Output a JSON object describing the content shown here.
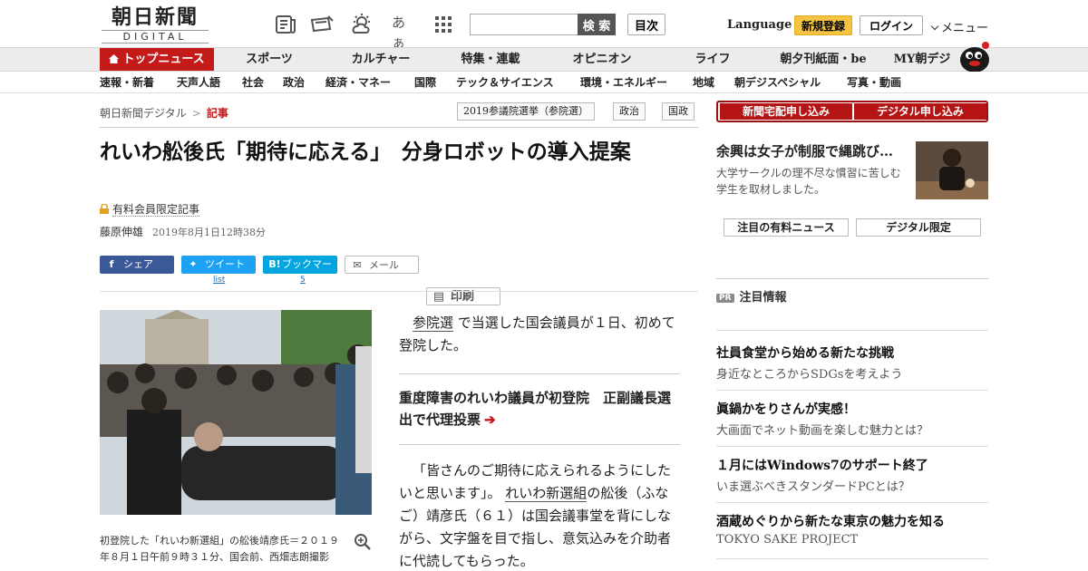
{
  "header": {
    "logo_main": "朝日新聞",
    "logo_sub": "DIGITAL",
    "search_button": "検 索",
    "toc_button": "目次",
    "language": "Language",
    "signup": "新規登録",
    "login": "ログイン",
    "menu": "メニュー",
    "font_icon_label": "あぁ"
  },
  "nav": {
    "items": [
      "トップニュース",
      "スポーツ",
      "カルチャー",
      "特集・連載",
      "オピニオン",
      "ライフ",
      "朝夕刊紙面・be",
      "MY朝デジ"
    ]
  },
  "subnav": {
    "items": [
      "速報・新着",
      "天声人語",
      "社会",
      "政治",
      "経済・マネー",
      "国際",
      "テック＆サイエンス",
      "環境・エネルギー",
      "地域",
      "朝デジスペシャル",
      "写真・動画"
    ]
  },
  "breadcrumb": {
    "home": "朝日新聞デジタル",
    "separator": ">",
    "current": "記事"
  },
  "tags": [
    "2019参議院選挙（参院選）",
    "政治",
    "国政"
  ],
  "article": {
    "headline": "れいわ舩後氏「期待に応える」　分身ロボットの導入提案",
    "paid_label": "有料会員限定記事",
    "author": "藤原伸雄",
    "date": "2019年8月1日12時38分",
    "share": {
      "facebook": "シェア",
      "twitter": "ツイート",
      "hatena": "ブックマーク",
      "mail": "メール",
      "print": "印刷",
      "twitter_count": "list",
      "hatena_count": "5"
    },
    "caption": "初登院した「れいわ新選組」の舩後靖彦氏＝２０１９年８月１日午前９時３１分、国会前、西畑志朗撮影",
    "lead_link": "参院選",
    "lead_rest": "で当選した国会議員が１日、初めて登院した。",
    "related": "重度障害のれいわ議員が初登院　正副議長選出で代理投票",
    "related_arrow": "➔",
    "body_a": "「皆さんのご期待に応えられるようにしたいと思います」。",
    "body_link": "れいわ新選組",
    "body_b": "の舩後（ふなご）靖彦氏（６１）は国会議事堂を背にしながら、文字盤を目で指し、意気込みを介助者に代読してもらった。"
  },
  "sidebar": {
    "subscribe_paper": "新聞宅配申し込み",
    "subscribe_digital": "デジタル申し込み",
    "feature_title": "余興は女子が制服で縄跳び…",
    "feature_desc": "大学サークルの理不尽な慣習に苦しむ学生を取材しました。",
    "tab_paid": "注目の有料ニュース",
    "tab_digital": "デジタル限定",
    "pr_badge": "PR",
    "pr_title": "注目情報",
    "pr_items": [
      {
        "title": "社員食堂から始める新たな挑戦",
        "desc": "身近なところからSDGsを考えよう"
      },
      {
        "title": "眞鍋かをりさんが実感！",
        "desc": "大画面でネット動画を楽しむ魅力とは？"
      },
      {
        "title": "１月にはWindows7のサポート終了",
        "desc": "いま選ぶべきスタンダードPCとは？"
      },
      {
        "title": "酒蔵めぐりから新たな東京の魅力を知る",
        "desc": "TOKYO SAKE PROJECT"
      }
    ]
  },
  "colors": {
    "accent_red": "#c41a1a",
    "signup_yellow": "#f6c342",
    "facebook": "#3b5998",
    "twitter": "#1da1f2",
    "hatena": "#00a4de"
  }
}
